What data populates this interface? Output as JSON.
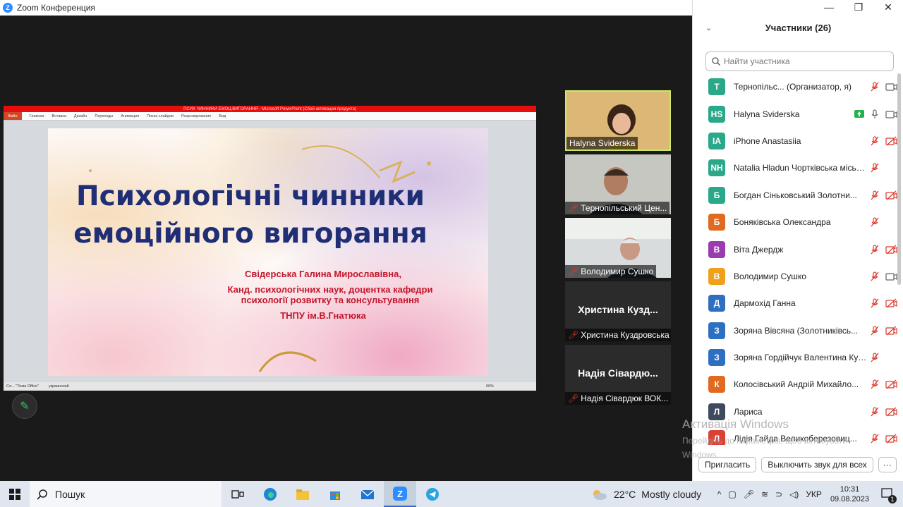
{
  "window": {
    "title": "Zoom Конференция",
    "controls": [
      "—",
      "❐",
      "✕"
    ]
  },
  "slide": {
    "pp_title": "ПСИХ ЧИННИКИ ЕМОЦ.ВИГОРАННЯ - Microsoft PowerPoint (Сбой активации продукта)",
    "ribbon_file": "Файл",
    "ribbon_tabs": [
      "Главная",
      "Вставка",
      "Дизайн",
      "Переходы",
      "Анимация",
      "Показ слайдов",
      "Рецензирование",
      "Вид"
    ],
    "title_line1": "Психологічні чинники",
    "title_line2": "емоційного вигорання",
    "author": "Свідерська Галина Мирославівна,",
    "degree_line1": "Канд. психологічних наук, доцентка кафедри",
    "degree_line2": "психології розвитку та консультування",
    "university": "ТНПУ ім.В.Гнатюка",
    "status_left": "Сл... \"Тема Office\"",
    "status_lang": "украинский",
    "zoom": "66%"
  },
  "videos": [
    {
      "name": "Halyna Sviderska",
      "muted": false
    },
    {
      "name": "Тернопільський Цен...",
      "muted": true
    },
    {
      "name": "Володимир Сушко",
      "muted": true
    },
    {
      "name": "Христина Куздровська",
      "big": "Христина  Кузд...",
      "muted": true
    },
    {
      "name": "Надія Сівардюк ВОК...",
      "big": "Надія Сівардю...",
      "muted": true
    }
  ],
  "participants_panel": {
    "title": "Участники (26)",
    "search_placeholder": "Найти участника",
    "participants": [
      {
        "initials": "Т",
        "color": "#2aa889",
        "name": "Тернопільс... (Организатор, я)",
        "mic": "off",
        "cam": "on"
      },
      {
        "initials": "HS",
        "color": "#2aa889",
        "name": "Halyna Sviderska",
        "share": true,
        "mic": "on",
        "cam": "on"
      },
      {
        "initials": "IA",
        "color": "#2aa889",
        "name": "iPhone Anastasiia",
        "mic": "off",
        "cam": "off"
      },
      {
        "initials": "NH",
        "color": "#2aa889",
        "name": "Natalia Hladun Чортківська міська ...",
        "mic": "off",
        "cam": "none"
      },
      {
        "initials": "Б",
        "color": "#2aa889",
        "name": "Богдан Сіньковський Золотни...",
        "mic": "off",
        "cam": "off"
      },
      {
        "initials": "Б",
        "color": "#e06a1f",
        "name": "Боняківська Олександра",
        "mic": "off",
        "cam": "none"
      },
      {
        "initials": "В",
        "color": "#9a3bb0",
        "name": "Віта Джердж",
        "mic": "off",
        "cam": "off"
      },
      {
        "initials": "В",
        "color": "#f0a11c",
        "name": "Володимир Сушко",
        "mic": "off",
        "cam": "on"
      },
      {
        "initials": "Д",
        "color": "#2f6fc2",
        "name": "Дармохід Ганна",
        "mic": "off",
        "cam": "off"
      },
      {
        "initials": "З",
        "color": "#2f6fc2",
        "name": "Зоряна Вівсяна (Золотниківсь...",
        "mic": "off",
        "cam": "off"
      },
      {
        "initials": "З",
        "color": "#2f6fc2",
        "name": "Зоряна Гордійчук Валентина Кури...",
        "mic": "off",
        "cam": "none"
      },
      {
        "initials": "К",
        "color": "#e06a1f",
        "name": "Колосівський Андрій Михайло...",
        "mic": "off",
        "cam": "off"
      },
      {
        "initials": "Л",
        "color": "#3f4a5c",
        "name": "Лариса",
        "mic": "off",
        "cam": "off"
      },
      {
        "initials": "Л",
        "color": "#d94234",
        "name": "Лідія Гайда Великоберезовиц...",
        "mic": "off",
        "cam": "off"
      }
    ],
    "invite_btn": "Пригласить",
    "mute_all_btn": "Выключить звук для всех",
    "more_btn": "···"
  },
  "watermark": {
    "line1": "Активація Windows",
    "line2": "Перейдіть до параметрів, щоб активувати Windows."
  },
  "taskbar": {
    "search": "Пошук",
    "temperature": "22°C",
    "weather": "Mostly cloudy",
    "lang": "УКР",
    "time": "10:31",
    "date": "09.08.2023",
    "notifications": "1"
  },
  "colors": {
    "zoom_blue": "#2d8cff",
    "muted_red": "#e0382c",
    "speaker_frame": "#c9e86b",
    "slide_title": "#1f2e75",
    "slide_red": "#c3162a"
  }
}
